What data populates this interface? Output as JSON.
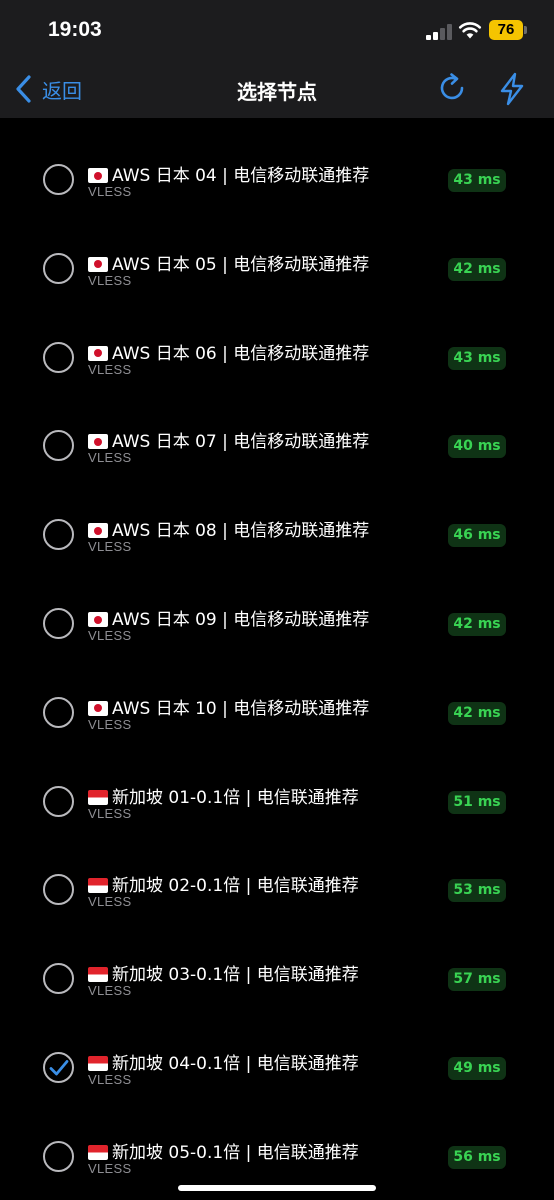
{
  "status": {
    "time": "19:03",
    "battery": "76"
  },
  "nav": {
    "back_label": "返回",
    "title": "选择节点"
  },
  "nodes": [
    {
      "flag": "jp",
      "name": "AWS 日本 04 | 电信移动联通推荐",
      "protocol": "VLESS",
      "latency": "43 ms",
      "selected": false
    },
    {
      "flag": "jp",
      "name": "AWS 日本 05 | 电信移动联通推荐",
      "protocol": "VLESS",
      "latency": "42 ms",
      "selected": false
    },
    {
      "flag": "jp",
      "name": "AWS 日本 06 | 电信移动联通推荐",
      "protocol": "VLESS",
      "latency": "43 ms",
      "selected": false
    },
    {
      "flag": "jp",
      "name": "AWS 日本 07 | 电信移动联通推荐",
      "protocol": "VLESS",
      "latency": "40 ms",
      "selected": false
    },
    {
      "flag": "jp",
      "name": "AWS 日本 08 | 电信移动联通推荐",
      "protocol": "VLESS",
      "latency": "46 ms",
      "selected": false
    },
    {
      "flag": "jp",
      "name": "AWS 日本 09 | 电信移动联通推荐",
      "protocol": "VLESS",
      "latency": "42 ms",
      "selected": false
    },
    {
      "flag": "jp",
      "name": "AWS 日本 10 | 电信移动联通推荐",
      "protocol": "VLESS",
      "latency": "42 ms",
      "selected": false
    },
    {
      "flag": "sg",
      "name": "新加坡 01-0.1倍 | 电信联通推荐",
      "protocol": "VLESS",
      "latency": "51 ms",
      "selected": false
    },
    {
      "flag": "sg",
      "name": "新加坡 02-0.1倍 | 电信联通推荐",
      "protocol": "VLESS",
      "latency": "53 ms",
      "selected": false
    },
    {
      "flag": "sg",
      "name": "新加坡 03-0.1倍 | 电信联通推荐",
      "protocol": "VLESS",
      "latency": "57 ms",
      "selected": false
    },
    {
      "flag": "sg",
      "name": "新加坡 04-0.1倍 | 电信联通推荐",
      "protocol": "VLESS",
      "latency": "49 ms",
      "selected": true
    },
    {
      "flag": "sg",
      "name": "新加坡 05-0.1倍 | 电信联通推荐",
      "protocol": "VLESS",
      "latency": "56 ms",
      "selected": false
    }
  ],
  "icons": {
    "back": "chevron-left-icon",
    "refresh": "refresh-icon",
    "speedtest": "lightning-bolt-icon",
    "selected": "checkmark-icon"
  },
  "colors": {
    "accent": "#3a8ee6",
    "latency_text": "#39d353",
    "latency_bg": "#0f3315",
    "battery": "#f5c400"
  }
}
